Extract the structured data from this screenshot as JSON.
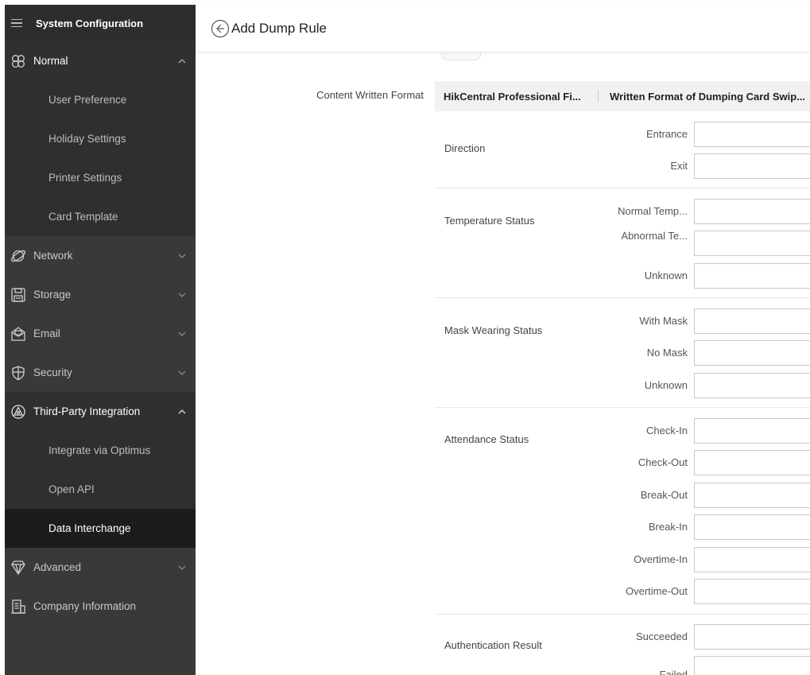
{
  "sidebar": {
    "title": "System Configuration",
    "groups": {
      "normal": {
        "label": "Normal",
        "items": [
          "User Preference",
          "Holiday Settings",
          "Printer Settings",
          "Card Template"
        ]
      },
      "network": {
        "label": "Network"
      },
      "storage": {
        "label": "Storage"
      },
      "email": {
        "label": "Email"
      },
      "security": {
        "label": "Security"
      },
      "third_party": {
        "label": "Third-Party Integration",
        "items": [
          "Integrate via Optimus",
          "Open API",
          "Data Interchange"
        ]
      },
      "advanced": {
        "label": "Advanced"
      },
      "company": {
        "label": "Company Information"
      }
    },
    "active_item": "Data Interchange"
  },
  "header": {
    "title": "Add Dump Rule"
  },
  "form": {
    "content_written_format_label": "Content Written Format",
    "table": {
      "col1": "HikCentral Professional Fi...",
      "col2": "Written Format of Dumping Card Swip..."
    },
    "groups": {
      "direction": {
        "label": "Direction",
        "rows": [
          "Entrance",
          "Exit"
        ]
      },
      "temperature": {
        "label": "Temperature Status",
        "rows": [
          "Normal Temp...",
          "Abnormal Te...",
          "Unknown"
        ]
      },
      "mask": {
        "label": "Mask Wearing Status",
        "rows": [
          "With Mask",
          "No Mask",
          "Unknown"
        ]
      },
      "attendance": {
        "label": "Attendance Status",
        "rows": [
          "Check-In",
          "Check-Out",
          "Break-Out",
          "Break-In",
          "Overtime-In",
          "Overtime-Out"
        ]
      },
      "authentication": {
        "label": "Authentication Result",
        "rows": [
          "Succeeded",
          "Failed"
        ]
      }
    }
  },
  "icons": {
    "menu": "hamburger-icon",
    "normal": "clover-icon",
    "network": "planet-icon",
    "storage": "floppy-disk-icon",
    "email": "envelope-icon",
    "security": "shield-icon",
    "third_party": "triangle-circle-icon",
    "advanced": "diamond-icon",
    "company": "building-icon",
    "back": "back-arrow-icon"
  },
  "colors": {
    "sidebar_bg": "#393939",
    "sidebar_active": "#1c1c1c",
    "accent": "#3d7ee0"
  }
}
